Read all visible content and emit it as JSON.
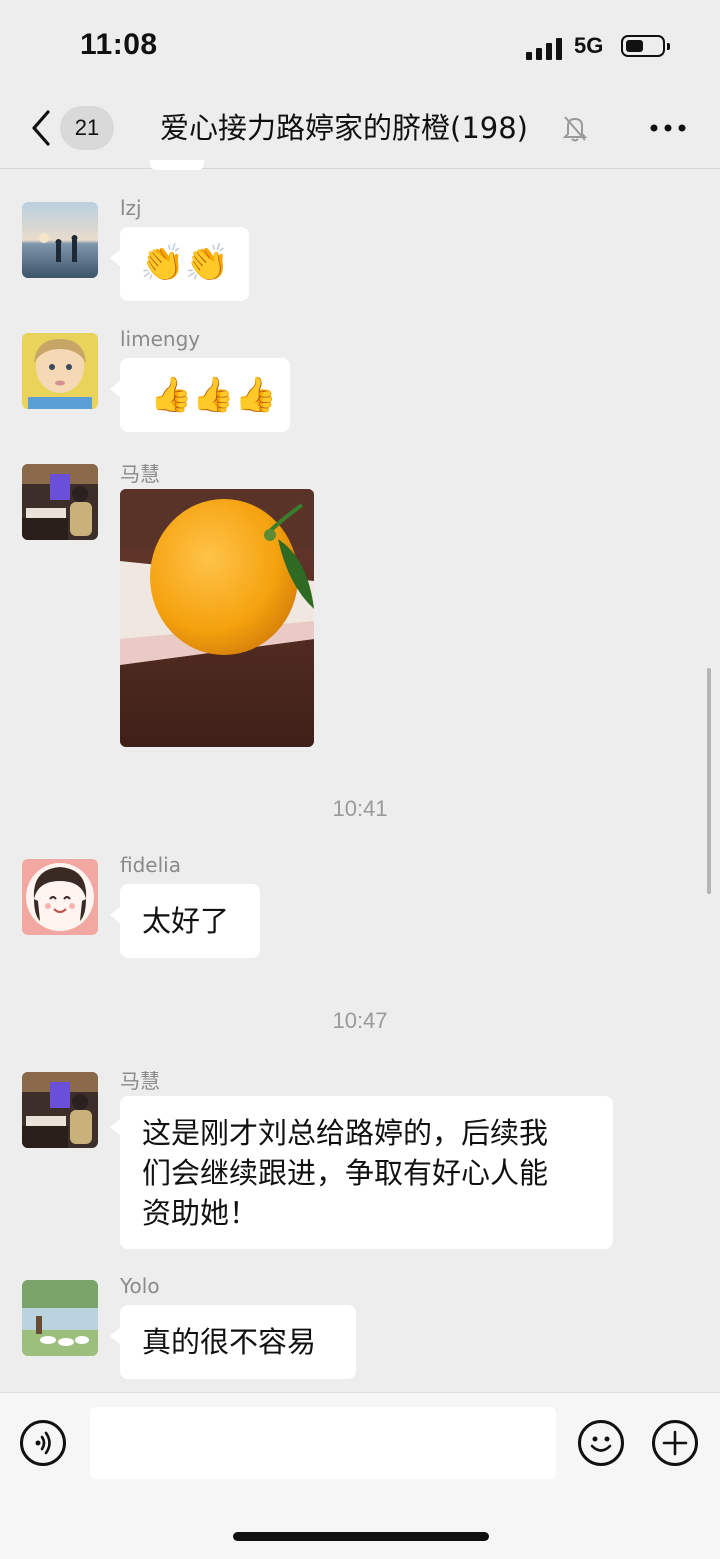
{
  "status_bar": {
    "time": "11:08",
    "network": "5G",
    "battery_level": 0.5
  },
  "nav": {
    "unread_count": "21",
    "title": "爱心接力路婷家的脐橙(198)",
    "muted": true
  },
  "messages": [
    {
      "sender": "lzj",
      "content": "👏👏"
    },
    {
      "sender": "limengy",
      "content": "👍👍👍"
    },
    {
      "sender": "马慧",
      "content": "image"
    },
    {
      "timestamp": "10:41"
    },
    {
      "sender": "fidelia",
      "text": "太好了"
    },
    {
      "timestamp": "10:47"
    },
    {
      "sender": "马慧",
      "lines": [
        "这是刚才刘总给路婷的，后续我",
        "们会继续跟进，争取有好心人能",
        "资助她！"
      ]
    },
    {
      "sender": "Yolo",
      "text": "真的很不容易"
    }
  ],
  "icons": {
    "back": "chevron-left-icon",
    "mute": "bell-off-icon",
    "more": "more-dots-icon",
    "voice": "voice-icon",
    "emoji": "emoji-icon",
    "add": "plus-icon"
  }
}
